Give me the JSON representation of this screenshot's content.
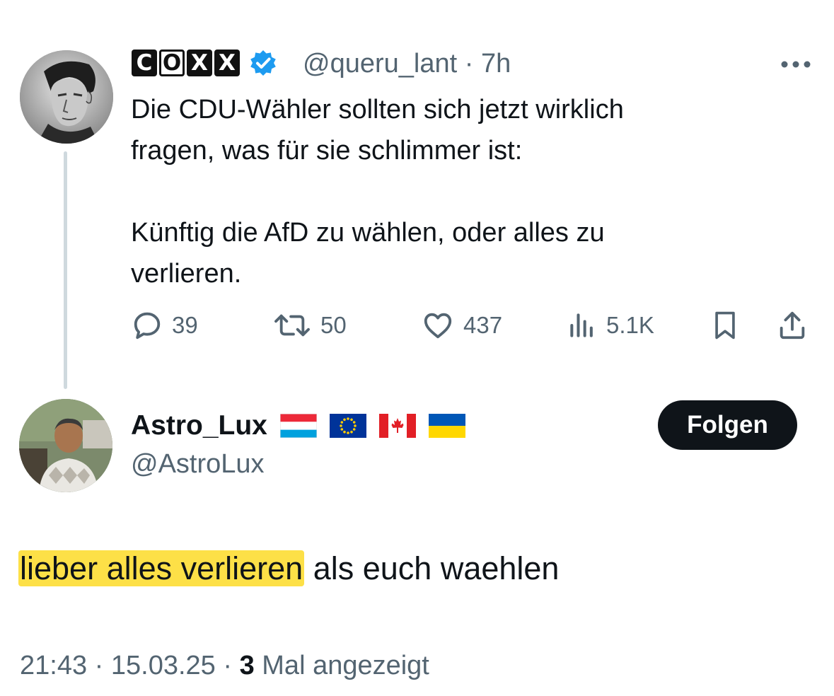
{
  "tweet": {
    "author_name_letters": [
      "C",
      "O",
      "X",
      "X"
    ],
    "author_handle": "@queru_lant",
    "separator": " · ",
    "time_ago": "7h",
    "text": "Die CDU-Wähler sollten sich jetzt wirklich\nfragen, was für sie schlimmer ist:\n\nKünftig die AfD zu wählen, oder alles zu\nverlieren.",
    "replies": "39",
    "reposts": "50",
    "likes": "437",
    "views": "5.1K",
    "icons": [
      "more-icon",
      "reply-icon",
      "repost-icon",
      "like-icon",
      "views-icon",
      "bookmark-icon",
      "share-icon",
      "verified-icon"
    ],
    "verified_color": "#1d9bf0"
  },
  "reply": {
    "author_name": "Astro_Lux",
    "author_handle": "@AstroLux",
    "flags": [
      "luxembourg-flag",
      "eu-flag",
      "canada-flag",
      "ukraine-flag"
    ],
    "follow_label": "Folgen",
    "text_highlighted": "lieber alles verlieren",
    "text_rest": " als euch waehlen",
    "highlight_color": "#fde047"
  },
  "footer": {
    "time": "21:43",
    "sep1": " · ",
    "date": "15.03.25",
    "sep2": " · ",
    "views_count": "3",
    "views_label": " Mal angezeigt"
  }
}
